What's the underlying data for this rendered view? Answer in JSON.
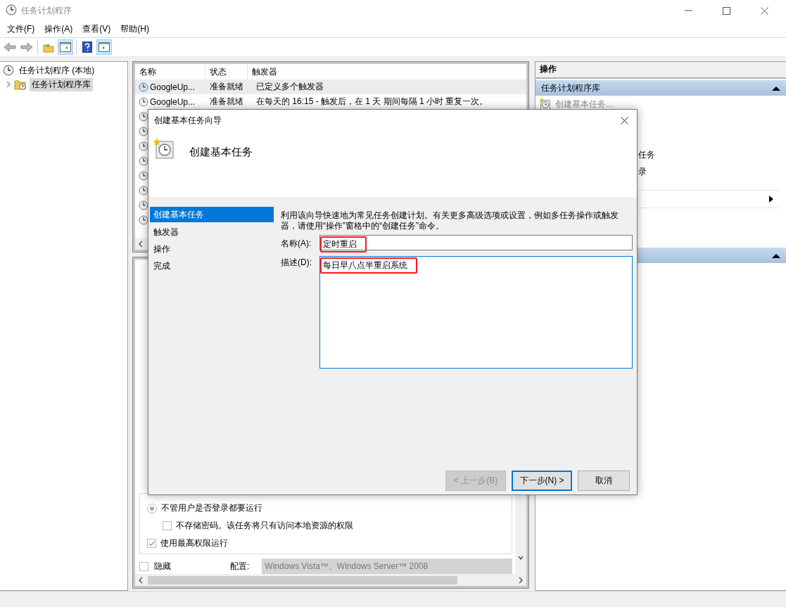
{
  "window": {
    "title": "任务计划程序"
  },
  "menu": [
    {
      "label": "文件(F)"
    },
    {
      "label": "操作(A)"
    },
    {
      "label": "查看(V)"
    },
    {
      "label": "帮助(H)"
    }
  ],
  "toolbar": [
    {
      "kind": "back",
      "selected": false
    },
    {
      "kind": "forward",
      "selected": false
    },
    {
      "kind": "separator"
    },
    {
      "kind": "up",
      "selected": false
    },
    {
      "kind": "tree-panel",
      "selected": true
    },
    {
      "kind": "separator"
    },
    {
      "kind": "help",
      "selected": false
    },
    {
      "kind": "actions-panel",
      "selected": true
    }
  ],
  "tree": {
    "items": [
      {
        "label": "任务计划程序 (本地)",
        "selected": false,
        "children": [
          {
            "label": "任务计划程序库",
            "selected": true,
            "expanded": false
          }
        ]
      }
    ]
  },
  "task_list": {
    "columns": [
      "名称",
      "状态",
      "触发器"
    ],
    "rows": [
      {
        "name": "GoogleUp...",
        "status": "准备就绪",
        "trigger": "已定义多个触发器",
        "selected": true
      },
      {
        "name": "GoogleUp...",
        "status": "准备就绪",
        "trigger": "在每天的 16:15 - 触发后，在 1 天 期间每隔 1 小时 重复一次。",
        "selected": false
      },
      {
        "selected": false
      },
      {
        "selected": false
      },
      {
        "selected": false
      },
      {
        "selected": false
      },
      {
        "selected": false
      },
      {
        "selected": false
      },
      {
        "selected": false
      },
      {
        "selected": false
      }
    ]
  },
  "detail": {
    "options": [
      {
        "kind": "radio",
        "label": "不管用户是否登录都要运行",
        "selected": true,
        "children": [
          {
            "kind": "checkbox",
            "label": "不存储密码。该任务将只有访问本地资源的权限",
            "checked": false
          }
        ]
      },
      {
        "kind": "checkbox",
        "label": "使用最高权限运行",
        "checked": true
      }
    ],
    "hidden_option": {
      "label": "隐藏",
      "checked": false
    },
    "config": {
      "label": "配置:",
      "value": "Windows Vista™、Windows Server™ 2008"
    }
  },
  "actions": {
    "title": "操作",
    "sections": [
      {
        "title": "任务计划程序库",
        "expanded": true,
        "items": [
          {
            "kind": "icon",
            "label": "创建基本任务..."
          },
          {
            "kind": "fragment",
            "label": "任务"
          },
          {
            "kind": "fragment",
            "label": "录"
          },
          {
            "kind": "submenu"
          }
        ]
      },
      {
        "expanded": true
      }
    ]
  },
  "dialog": {
    "title": "创建基本任务向导",
    "heading": "创建基本任务",
    "steps": [
      {
        "label": "创建基本任务",
        "selected": true
      },
      {
        "label": "触发器",
        "selected": false
      },
      {
        "label": "操作",
        "selected": false
      },
      {
        "label": "完成",
        "selected": false
      }
    ],
    "intro": "利用该向导快速地为常见任务创建计划。有关更多高级选项或设置，例如多任务操作或触发器，请使用“操作”窗格中的“创建任务”命令。",
    "fields": [
      {
        "kind": "line",
        "label": "名称(A):",
        "value": "定时重启",
        "marked": true,
        "focused": false
      },
      {
        "kind": "area",
        "label": "描述(D):",
        "value": "每日早八点半重启系统",
        "marked": true,
        "focused": true
      }
    ],
    "buttons": [
      {
        "label": "< 上一步(B)",
        "disabled": true,
        "default": false
      },
      {
        "label": "下一步(N) >",
        "disabled": false,
        "default": true
      },
      {
        "label": "取消",
        "disabled": false,
        "default": false
      }
    ]
  }
}
